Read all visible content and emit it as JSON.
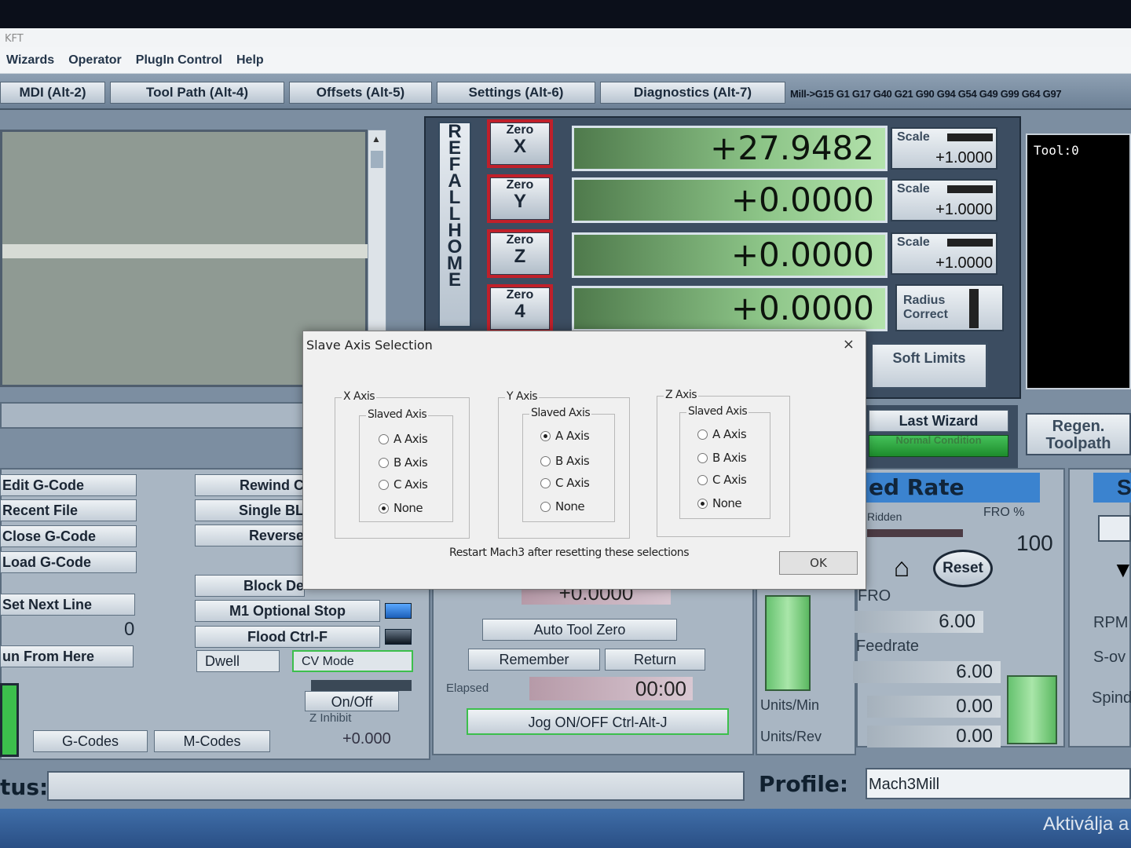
{
  "window": {
    "title": "KFT"
  },
  "menu": [
    "Wizards",
    "Operator",
    "PlugIn Control",
    "Help"
  ],
  "tabs": [
    "MDI (Alt-2)",
    "Tool Path (Alt-4)",
    "Offsets (Alt-5)",
    "Settings (Alt-6)",
    "Diagnostics (Alt-7)"
  ],
  "modal_codes": "Mill->G15  G1 G17 G40 G21 G90 G94 G54 G49 G99 G64 G97",
  "ref_home": "REF ALL HOME",
  "axes": [
    {
      "zero_label": "Zero",
      "axis": "X",
      "dro": "+27.9482",
      "side_label": "Scale",
      "side_value": "+1.0000"
    },
    {
      "zero_label": "Zero",
      "axis": "Y",
      "dro": "+0.0000",
      "side_label": "Scale",
      "side_value": "+1.0000"
    },
    {
      "zero_label": "Zero",
      "axis": "Z",
      "dro": "+0.0000",
      "side_label": "Scale",
      "side_value": "+1.0000"
    },
    {
      "zero_label": "Zero",
      "axis": "4",
      "dro": "+0.0000"
    }
  ],
  "radius_correct": "Radius Correct",
  "soft_limits": "Soft Limits",
  "tool_display": "Tool:0",
  "last_wizard": "Last Wizard",
  "normal_condition": "Normal Condition",
  "regen_toolpath": "Regen. Toolpath",
  "file_buttons": [
    "Edit G-Code",
    "Recent File",
    "Close G-Code",
    "Load G-Code",
    "Set Next Line"
  ],
  "line_number": "0",
  "run_from_here": "un From Here",
  "control_buttons": [
    "Rewind C",
    "Single BL",
    "Reverse",
    "Block De",
    "M1 Optional Stop",
    "Flood Ctrl-F"
  ],
  "dwell": "Dwell",
  "cv_mode": "CV Mode",
  "on_off": "On/Off",
  "z_inhibit": {
    "label": "Z Inhibit",
    "value": "+0.000"
  },
  "gcodes_btn": "G-Codes",
  "mcodes_btn": "M-Codes",
  "center": {
    "partial_top": "+0.0000",
    "auto_tool_zero": "Auto Tool Zero",
    "remember": "Remember",
    "return": "Return",
    "elapsed_label": "Elapsed",
    "elapsed_value": "00:00",
    "jog": "Jog ON/OFF Ctrl-Alt-J"
  },
  "feed": {
    "title": "ed Rate",
    "overridden": "Ridden",
    "fro_pct_label": "FRO %",
    "fro_pct_value": "100",
    "reset": "Reset",
    "fro_label": "FRO",
    "fro_value": "6.00",
    "feedrate_label": "Feedrate",
    "feedrate_value": "6.00",
    "units_min_label": "Units/Min",
    "units_min_value": "0.00",
    "units_rev_label": "Units/Rev",
    "units_rev_value": "0.00"
  },
  "spindle": {
    "rpm": "RPM",
    "sov": "S-ov",
    "spind": "Spind",
    "title": "S"
  },
  "status": {
    "label": "tus:",
    "profile_label": "Profile:",
    "profile_value": "Mach3Mill"
  },
  "activate_text": "Aktiválja a",
  "dialog": {
    "title": "Slave Axis Selection",
    "close": "×",
    "groups": [
      {
        "axis_label": "X Axis",
        "slaved_label": "Slaved Axis",
        "options": [
          "A Axis",
          "B Axis",
          "C Axis",
          "None"
        ],
        "selected": 3
      },
      {
        "axis_label": "Y Axis",
        "slaved_label": "Slaved Axis",
        "options": [
          "A Axis",
          "B Axis",
          "C Axis",
          "None"
        ],
        "selected": 0
      },
      {
        "axis_label": "Z Axis",
        "slaved_label": "Slaved Axis",
        "options": [
          "A Axis",
          "B Axis",
          "C Axis",
          "None"
        ],
        "selected": 3
      }
    ],
    "note": "Restart Mach3 after resetting these selections",
    "ok": "OK"
  }
}
